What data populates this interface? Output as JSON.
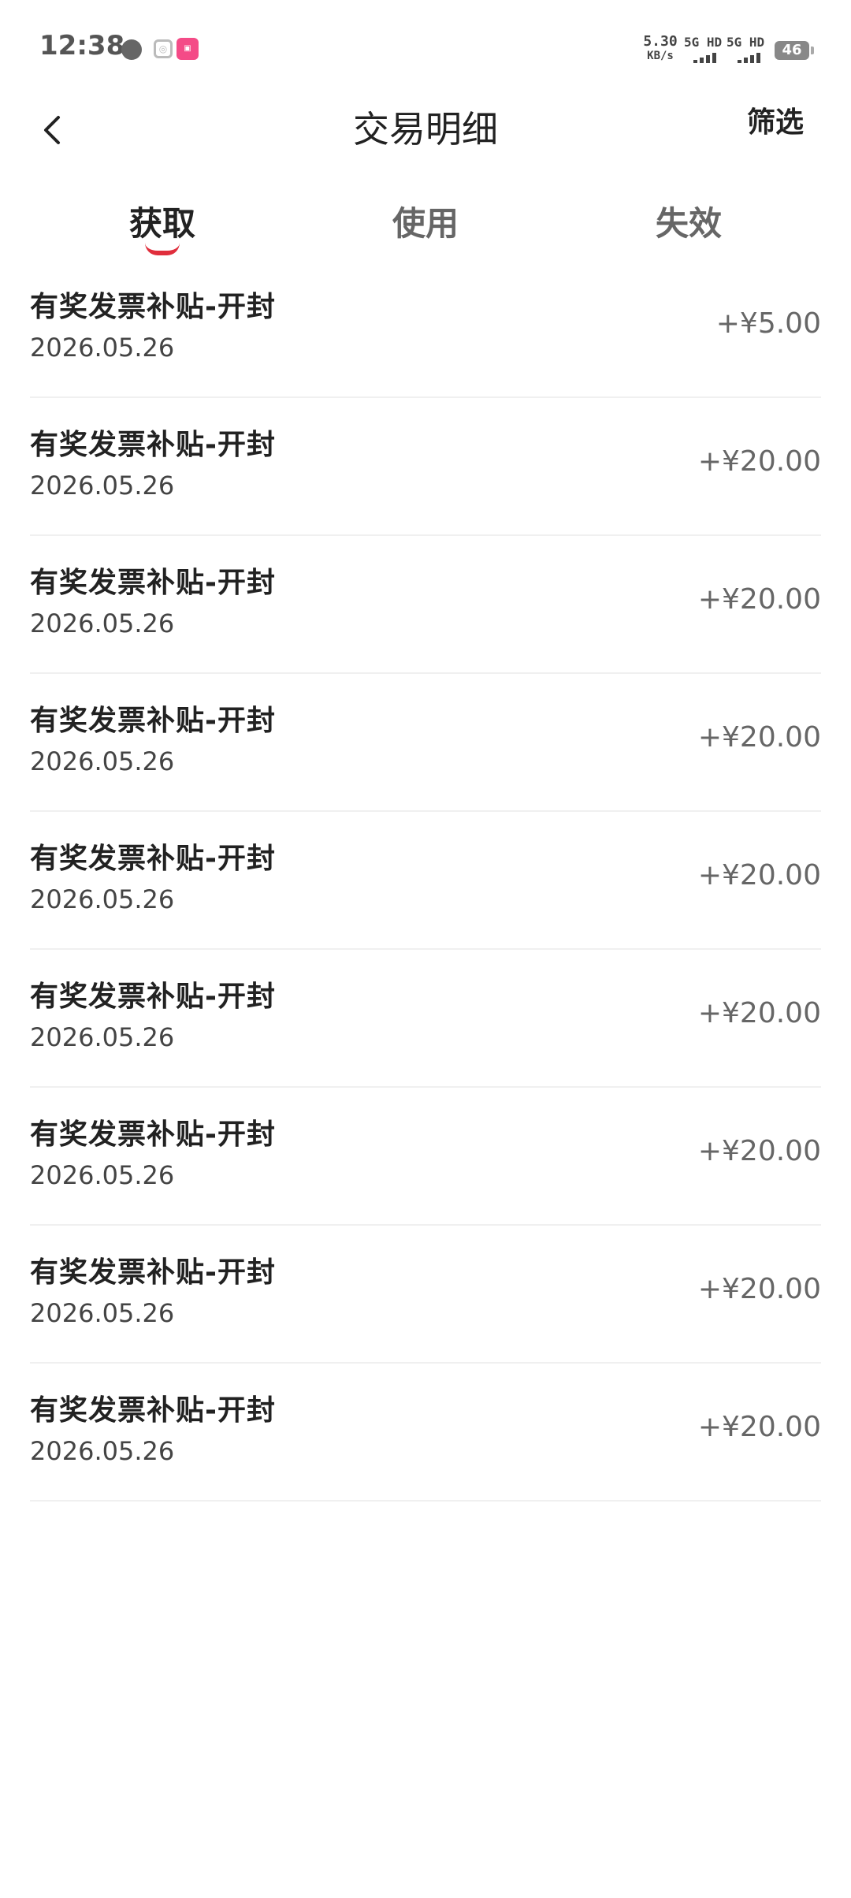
{
  "status_bar": {
    "time": "12:38",
    "speed_value": "5.30",
    "speed_unit": "KB/s",
    "network_1": "5G HD",
    "network_2": "5G HD",
    "battery": "46"
  },
  "header": {
    "title": "交易明细",
    "filter_label": "筛选"
  },
  "tabs": [
    {
      "label": "获取",
      "active": true
    },
    {
      "label": "使用",
      "active": false
    },
    {
      "label": "失效",
      "active": false
    }
  ],
  "accent_color": "#e02e3c",
  "transactions": [
    {
      "title": "有奖发票补贴-开封",
      "date": "2026.05.26",
      "amount": "+¥5.00"
    },
    {
      "title": "有奖发票补贴-开封",
      "date": "2026.05.26",
      "amount": "+¥20.00"
    },
    {
      "title": "有奖发票补贴-开封",
      "date": "2026.05.26",
      "amount": "+¥20.00"
    },
    {
      "title": "有奖发票补贴-开封",
      "date": "2026.05.26",
      "amount": "+¥20.00"
    },
    {
      "title": "有奖发票补贴-开封",
      "date": "2026.05.26",
      "amount": "+¥20.00"
    },
    {
      "title": "有奖发票补贴-开封",
      "date": "2026.05.26",
      "amount": "+¥20.00"
    },
    {
      "title": "有奖发票补贴-开封",
      "date": "2026.05.26",
      "amount": "+¥20.00"
    },
    {
      "title": "有奖发票补贴-开封",
      "date": "2026.05.26",
      "amount": "+¥20.00"
    },
    {
      "title": "有奖发票补贴-开封",
      "date": "2026.05.26",
      "amount": "+¥20.00"
    }
  ]
}
